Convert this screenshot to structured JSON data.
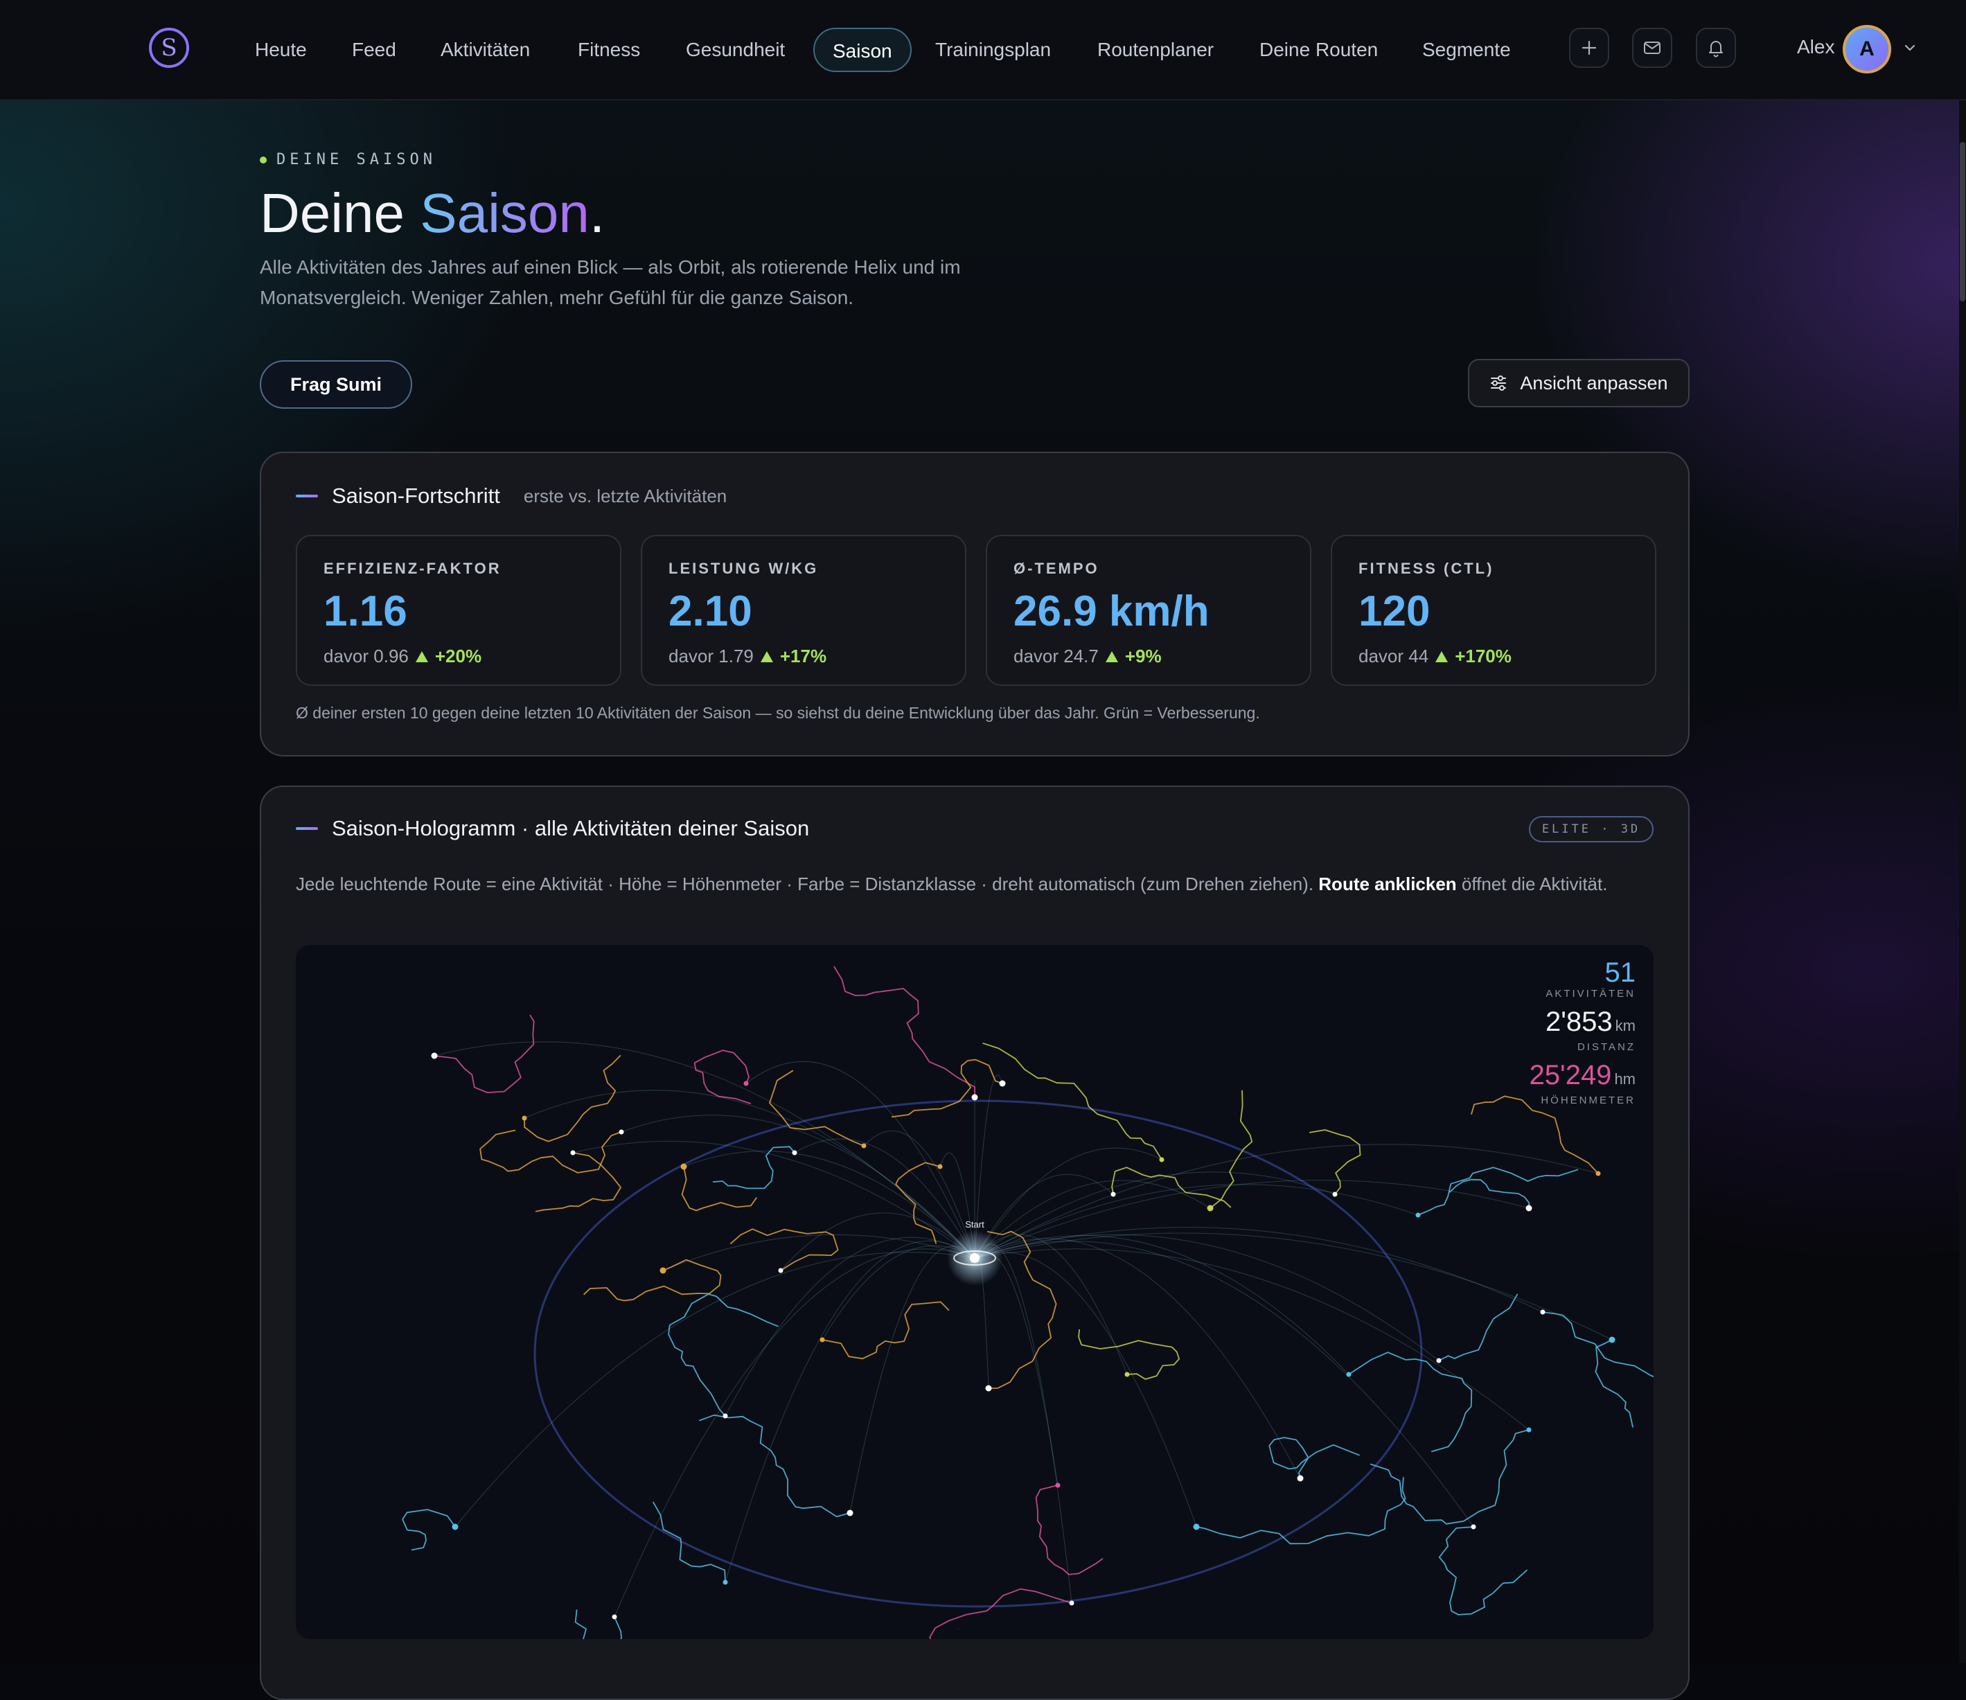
{
  "nav": {
    "items": [
      "Heute",
      "Feed",
      "Aktivitäten",
      "Fitness",
      "Gesundheit",
      "Saison",
      "Trainingsplan",
      "Routenplaner",
      "Deine Routen",
      "Segmente"
    ],
    "active": "Saison",
    "user_name": "Alex",
    "avatar_initial": "A",
    "logo_letter": "S",
    "icons": [
      "plus-icon",
      "mail-icon",
      "bell-icon"
    ]
  },
  "hero": {
    "eyebrow": "DEINE SAISON",
    "title_prefix": "Deine ",
    "title_accent": "Saison",
    "title_suffix": ".",
    "lead": "Alle Aktivitäten des Jahres auf einen Blick — als Orbit, als rotierende Helix und im Monatsvergleich. Weniger Zahlen, mehr Gefühl für die ganze Saison.",
    "ask_button": "Frag Sumi",
    "adjust_button": "Ansicht anpassen"
  },
  "progress": {
    "title": "Saison-Fortschritt",
    "subtitle": "erste vs. letzte Aktivitäten",
    "stats": [
      {
        "label": "EFFIZIENZ-FAKTOR",
        "value": "1.16",
        "before": "davor 0.96",
        "delta": "+20%"
      },
      {
        "label": "LEISTUNG W/KG",
        "value": "2.10",
        "before": "davor 1.79",
        "delta": "+17%"
      },
      {
        "label": "Ø-TEMPO",
        "value": "26.9 km/h",
        "before": "davor 24.7",
        "delta": "+9%"
      },
      {
        "label": "FITNESS (CTL)",
        "value": "120",
        "before": "davor 44",
        "delta": "+170%"
      }
    ],
    "footnote": "Ø deiner ersten 10 gegen deine letzten 10 Aktivitäten der Saison — so siehst du deine Entwicklung über das Jahr. Grün = Verbesserung."
  },
  "hologram": {
    "title": "Saison-Hologramm · alle Aktivitäten deiner Saison",
    "badge": "ELITE · 3D",
    "description": "Jede leuchtende Route = eine Aktivität · Höhe = Höhenmeter · Farbe = Distanzklasse · dreht automatisch (zum Drehen ziehen).",
    "description_bold": "Route anklicken",
    "description_end": " öffnet die Aktivität.",
    "start_label": "Start",
    "stats": {
      "activities": "51",
      "activities_label": "AKTIVITÄTEN",
      "distance": "2'853",
      "distance_unit": "km",
      "distance_label": "DISTANZ",
      "elevation": "25'249",
      "elevation_unit": "hm",
      "elevation_label": "HÖHENMETER"
    },
    "colors": {
      "short": "#55c1e6",
      "medium": "#e0a63a",
      "long": "#d9549a",
      "xl": "#c8d34a"
    }
  },
  "colors": {
    "accent_blue": "#62b4f5",
    "accent_purple": "#b168f0",
    "positive": "#a6e25c"
  }
}
